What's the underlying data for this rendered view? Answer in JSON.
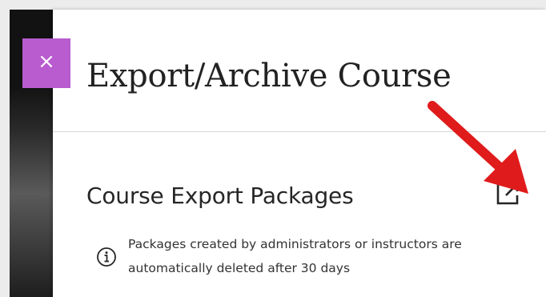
{
  "close_button": {
    "glyph": "×",
    "color": "#b85ccf"
  },
  "panel": {
    "title": "Export/Archive Course",
    "section_title": "Course Export Packages",
    "info_text": "Packages created by administrators or instructors are automatically deleted after 30 days"
  },
  "icons": {
    "open_in_new": "external-link-icon",
    "info": "info-icon",
    "annotation": "red-arrow"
  },
  "colors": {
    "accent": "#b85ccf",
    "arrow": "#e01b1b",
    "text": "#262626"
  }
}
